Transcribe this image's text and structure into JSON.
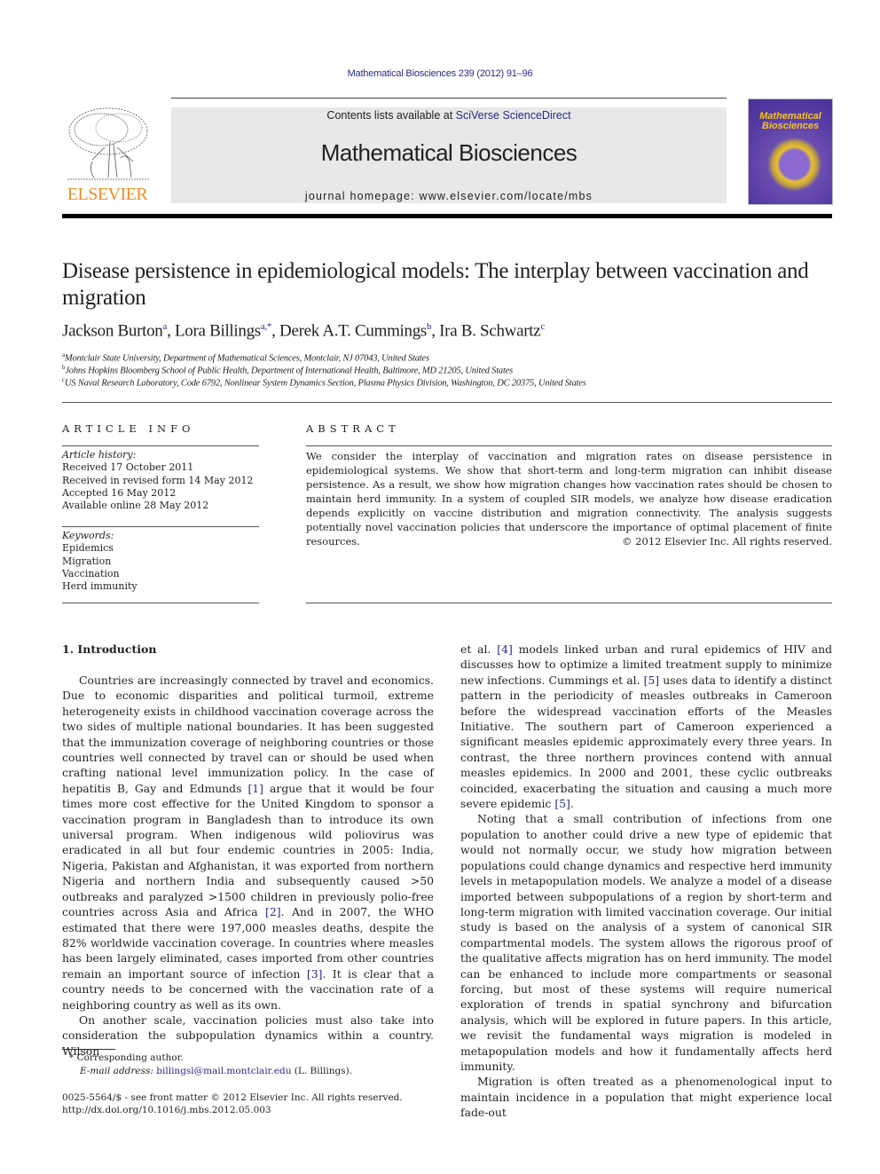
{
  "header": {
    "journal_ref": "Mathematical Biosciences 239 (2012) 91–96",
    "contents_prefix": "Contents lists available at ",
    "contents_link": "SciVerse ScienceDirect",
    "journal_name": "Mathematical Biosciences",
    "homepage": "journal homepage: www.elsevier.com/locate/mbs",
    "publisher_logo_text": "ELSEVIER",
    "cover_title_line1": "Mathematical",
    "cover_title_line2": "Biosciences",
    "colors": {
      "link": "#2a2a8c",
      "elsevier_orange": "#f28c28",
      "masthead_bg": "#e8e8e8",
      "cover_purple": "#5a3ea8",
      "cover_yellow": "#f5c518"
    }
  },
  "article": {
    "title": "Disease persistence in epidemiological models: The interplay between vaccination and migration",
    "authors": [
      {
        "name": "Jackson Burton",
        "sup": "a"
      },
      {
        "name": "Lora Billings",
        "sup": "a,*"
      },
      {
        "name": "Derek A.T. Cummings",
        "sup": "b"
      },
      {
        "name": "Ira B. Schwartz",
        "sup": "c"
      }
    ],
    "affiliations": [
      {
        "sup": "a",
        "text": "Montclair State University, Department of Mathematical Sciences, Montclair, NJ 07043, United States"
      },
      {
        "sup": "b",
        "text": "Johns Hopkins Bloomberg School of Public Health, Department of International Health, Baltimore, MD 21205, United States"
      },
      {
        "sup": "c",
        "text": "US Naval Research Laboratory, Code 6792, Nonlinear System Dynamics Section, Plasma Physics Division, Washington, DC 20375, United States"
      }
    ]
  },
  "article_info": {
    "heading": "ARTICLE INFO",
    "history_label": "Article history:",
    "history": [
      "Received 17 October 2011",
      "Received in revised form 14 May 2012",
      "Accepted 16 May 2012",
      "Available online 28 May 2012"
    ],
    "keywords_label": "Keywords:",
    "keywords": [
      "Epidemics",
      "Migration",
      "Vaccination",
      "Herd immunity"
    ]
  },
  "abstract": {
    "heading": "ABSTRACT",
    "text": "We consider the interplay of vaccination and migration rates on disease persistence in epidemiological systems. We show that short-term and long-term migration can inhibit disease persistence. As a result, we show how migration changes how vaccination rates should be chosen to maintain herd immunity. In a system of coupled SIR models, we analyze how disease eradication depends explicitly on vaccine distribution and migration connectivity. The analysis suggests potentially novel vaccination policies that underscore the importance of optimal placement of finite resources.",
    "copyright": "© 2012 Elsevier Inc. All rights reserved."
  },
  "body": {
    "section_heading": "1. Introduction",
    "left_p1_a": "Countries are increasingly connected by travel and economics. Due to economic disparities and political turmoil, extreme heterogeneity exists in childhood vaccination coverage across the two sides of multiple national boundaries. It has been suggested that the immunization coverage of neighboring countries or those countries well connected by travel can or should be used when crafting national level immunization policy. In the case of hepatitis B, Gay and Edmunds ",
    "ref1": "[1]",
    "left_p1_b": " argue that it would be four times more cost effective for the United Kingdom to sponsor a vaccination program in Bangladesh than to introduce its own universal program. When indigenous wild poliovirus was eradicated in all but four endemic countries in 2005: India, Nigeria, Pakistan and Afghanistan, it was exported from northern Nigeria and northern India and subsequently caused >50 outbreaks and paralyzed >1500 children in previously polio-free countries across Asia and Africa ",
    "ref2": "[2]",
    "left_p1_c": ". And in 2007, the WHO estimated that there were 197,000 measles deaths, despite the 82% worldwide vaccination coverage. In countries where measles has been largely eliminated, cases imported from other countries remain an important source of infection ",
    "ref3": "[3]",
    "left_p1_d": ". It is clear that a country needs to be concerned with the vaccination rate of a neighboring country as well as its own.",
    "left_p2": "On another scale, vaccination policies must also take into consideration the subpopulation dynamics within a country. Wilson",
    "right_p1_a": "et al. ",
    "ref4": "[4]",
    "right_p1_b": " models linked urban and rural epidemics of HIV and discusses how to optimize a limited treatment supply to minimize new infections. Cummings et al. ",
    "ref5": "[5]",
    "right_p1_c": " uses data to identify a distinct pattern in the periodicity of measles outbreaks in Cameroon before the widespread vaccination efforts of the Measles Initiative. The southern part of Cameroon experienced a significant measles epidemic approximately every three years. In contrast, the three northern provinces contend with annual measles epidemics. In 2000 and 2001, these cyclic outbreaks coincided, exacerbating the situation and causing a much more severe epidemic ",
    "ref5b": "[5]",
    "right_p1_d": ".",
    "right_p2": "Noting that a small contribution of infections from one population to another could drive a new type of epidemic that would not normally occur, we study how migration between populations could change dynamics and respective herd immunity levels in metapopulation models. We analyze a model of a disease imported between subpopulations of a region by short-term and long-term migration with limited vaccination coverage. Our initial study is based on the analysis of a system of canonical SIR compartmental models. The system allows the rigorous proof of the qualitative affects migration has on herd immunity. The model can be enhanced to include more compartments or seasonal forcing, but most of these systems will require numerical exploration of trends in spatial synchrony and bifurcation analysis, which will be explored in future papers. In this article, we revisit the fundamental ways migration is modeled in metapopulation models and how it fundamentally affects herd immunity.",
    "right_p3": "Migration is often treated as a phenomenological input to maintain incidence in a population that might experience local fade-out"
  },
  "footnotes": {
    "corresponding": "* Corresponding author.",
    "email_label": "E-mail address: ",
    "email": "billingsl@mail.montclair.edu",
    "email_suffix": " (L. Billings).",
    "issn_line": "0025-5564/$ - see front matter © 2012 Elsevier Inc. All rights reserved.",
    "doi": "http://dx.doi.org/10.1016/j.mbs.2012.05.003"
  }
}
